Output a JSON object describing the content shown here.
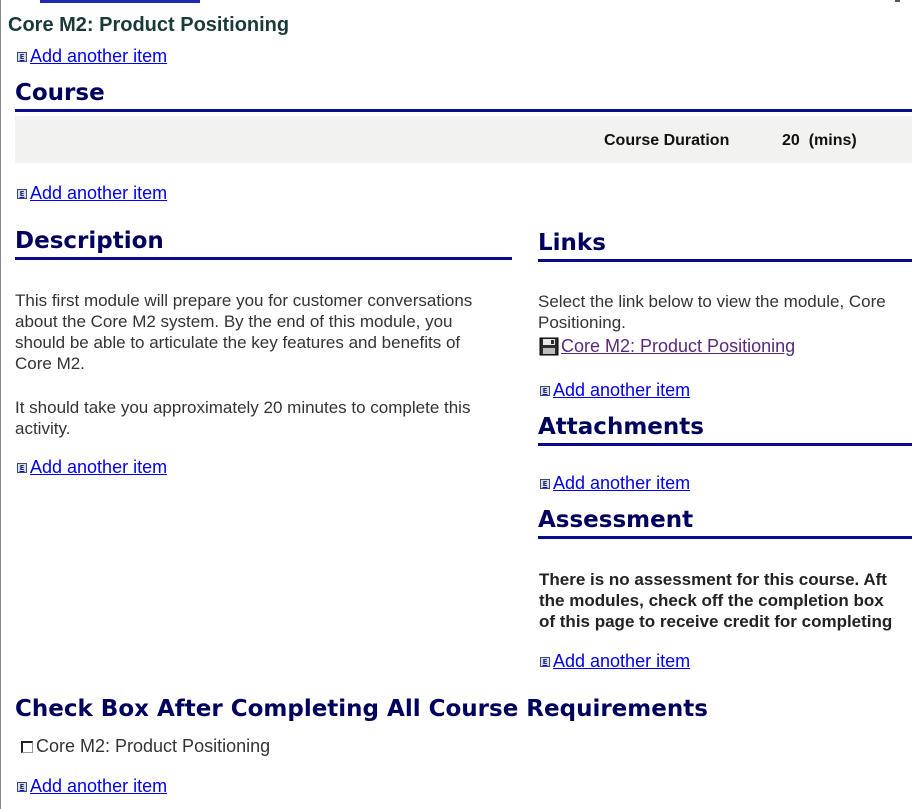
{
  "page": {
    "title": "Core M2: Product Positioning",
    "add_item_label": "Add another item"
  },
  "course": {
    "heading": "Course",
    "duration_label": "Course Duration",
    "duration_value": "20  (mins)"
  },
  "description": {
    "heading": "Description",
    "lines": [
      "This first module will prepare you for customer conversations",
      "about the Core M2 system. By the end of this module, you",
      "should be able to articulate the key features and benefits of",
      "Core M2."
    ],
    "lines2": [
      "It should take you approximately 20 minutes to complete this",
      "activity."
    ]
  },
  "links": {
    "heading": "Links",
    "lines": [
      "Select the link below to view the module, Core",
      "Positioning."
    ],
    "link_label": "Core M2: Product Positioning"
  },
  "attachments": {
    "heading": "Attachments"
  },
  "assessment": {
    "heading": "Assessment",
    "lines": [
      "There is no assessment for this course. Aft",
      "the modules, check off the completion box",
      "of this page to receive credit for completing"
    ]
  },
  "completion": {
    "heading": "Check Box After Completing All Course Requirements",
    "checkbox_label": "Core M2: Product Positioning"
  },
  "icons": {
    "add_item": "edit-icon",
    "link": "floppy-disk-icon",
    "checkbox": "checkbox-icon"
  },
  "colors": {
    "heading": "#00005e",
    "rule": "#0a0a8c",
    "link": "#0000ee",
    "visited_link": "#5a2a7a",
    "course_bar": "#f2f2f0"
  }
}
